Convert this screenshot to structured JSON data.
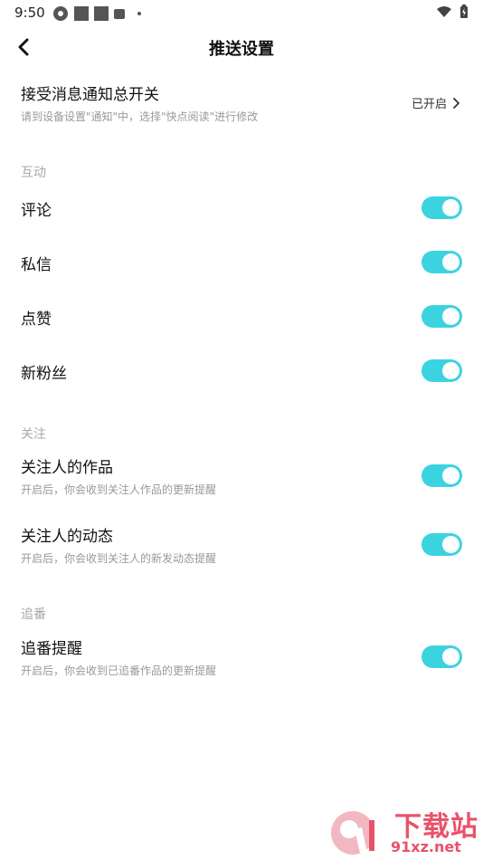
{
  "status_bar": {
    "time": "9:50"
  },
  "header": {
    "title": "推送设置"
  },
  "master": {
    "title": "接受消息通知总开关",
    "description": "请到设备设置\"通知\"中，选择\"快点阅读\"进行修改",
    "status": "已开启"
  },
  "sections": {
    "interaction": {
      "header": "互动",
      "items": [
        {
          "label": "评论",
          "enabled": true
        },
        {
          "label": "私信",
          "enabled": true
        },
        {
          "label": "点赞",
          "enabled": true
        },
        {
          "label": "新粉丝",
          "enabled": true
        }
      ]
    },
    "follow": {
      "header": "关注",
      "items": [
        {
          "label": "关注人的作品",
          "description": "开启后，你会收到关注人作品的更新提醒",
          "enabled": true
        },
        {
          "label": "关注人的动态",
          "description": "开启后，你会收到关注人的新发动态提醒",
          "enabled": true
        }
      ]
    },
    "chase": {
      "header": "追番",
      "items": [
        {
          "label": "追番提醒",
          "description": "开启后，你会收到已追番作品的更新提醒",
          "enabled": true
        }
      ]
    }
  },
  "watermark": {
    "main": "下载站",
    "sub": "91xz.net"
  },
  "colors": {
    "toggle_on": "#3cd3e1",
    "watermark": "#e8536a"
  }
}
